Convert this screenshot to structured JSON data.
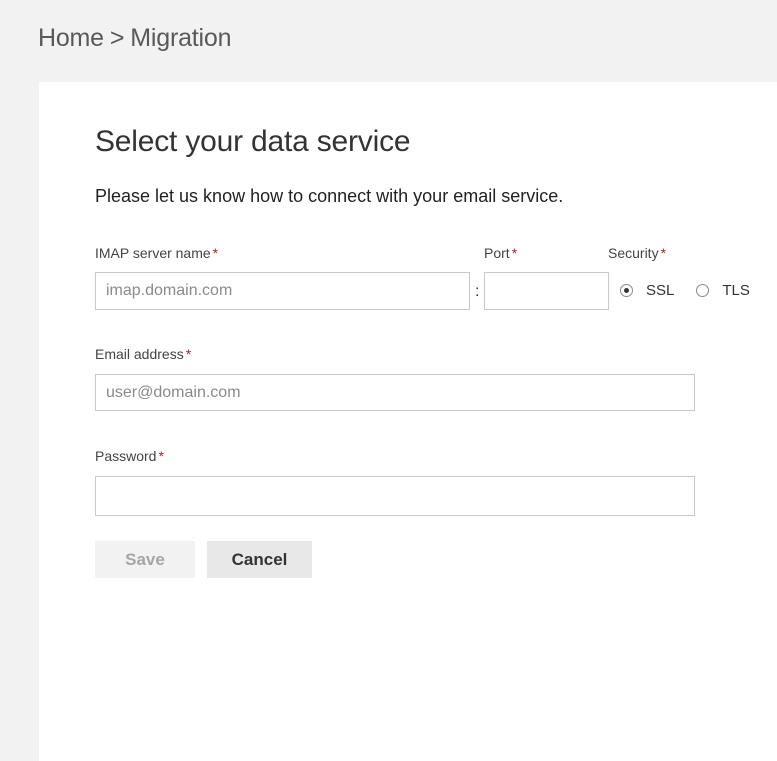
{
  "breadcrumb": {
    "home": "Home",
    "separator": ">",
    "current": "Migration"
  },
  "page": {
    "title": "Select your data service",
    "subtitle": "Please let us know how to connect with your email service."
  },
  "form": {
    "required_marker": "*",
    "imap": {
      "label": "IMAP server name",
      "placeholder": "imap.domain.com",
      "value": ""
    },
    "colon": ":",
    "port": {
      "label": "Port",
      "placeholder": "",
      "value": ""
    },
    "security": {
      "label": "Security",
      "options": [
        "SSL",
        "TLS"
      ],
      "selected": "SSL"
    },
    "email": {
      "label": "Email address",
      "placeholder": "user@domain.com",
      "value": ""
    },
    "password": {
      "label": "Password",
      "placeholder": "",
      "value": ""
    }
  },
  "actions": {
    "save_label": "Save",
    "cancel_label": "Cancel"
  },
  "colors": {
    "background": "#f2f2f2",
    "panel": "#ffffff",
    "required": "#a4262c",
    "input_border": "#c8c8c8"
  }
}
